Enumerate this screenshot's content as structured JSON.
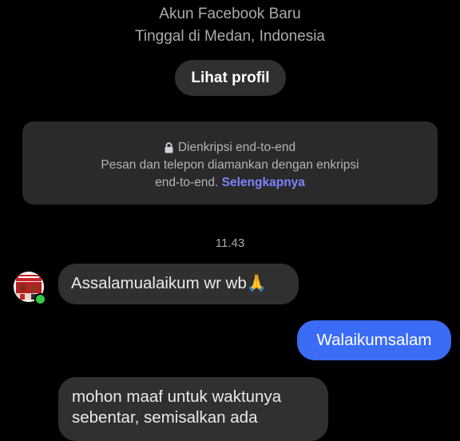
{
  "profile": {
    "subtitle": "Akun Facebook Baru",
    "location": "Tinggal di Medan, Indonesia",
    "view_profile_label": "Lihat profil"
  },
  "encryption_notice": {
    "title": "Dienkripsi end-to-end",
    "body_line1": "Pesan dan telepon diamankan dengan enkripsi",
    "body_line2": "end-to-end.",
    "link_label": "Selengkapnya",
    "lock_icon": "lock-icon"
  },
  "conversation": {
    "timestamp": "11.43",
    "messages": [
      {
        "direction": "incoming",
        "text": "Assalamualaikum wr wb🙏"
      },
      {
        "direction": "outgoing",
        "text": "Walaikumsalam"
      },
      {
        "direction": "incoming",
        "text": "mohon maaf untuk waktunya sebentar, semisalkan ada"
      }
    ]
  },
  "colors": {
    "background": "#000000",
    "incoming_bubble": "#303030",
    "outgoing_bubble": "#3a6cf5",
    "link": "#7c83fd",
    "online": "#31cc46"
  }
}
